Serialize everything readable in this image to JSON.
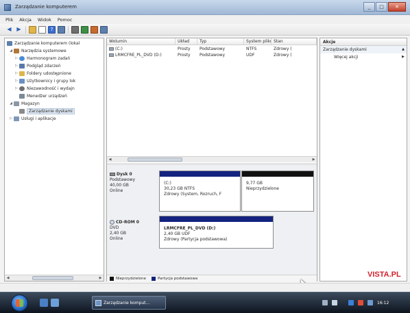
{
  "window": {
    "title": "Zarządzanie komputerem",
    "controls": [
      "_",
      "□",
      "✕"
    ]
  },
  "menu": [
    "Plik",
    "Akcja",
    "Widok",
    "Pomoc"
  ],
  "toolbar_icons": [
    "back-icon",
    "forward-icon",
    "up-folder-icon",
    "properties-icon",
    "help-icon",
    "console-tree-icon",
    "disk-icon",
    "check-icon",
    "volume-icon",
    "refresh-icon"
  ],
  "tree": {
    "items": [
      {
        "label": "Zarządzanie komputerem (lokal",
        "level": 0,
        "expander": ""
      },
      {
        "label": "Narzędzia systemowe",
        "level": 1,
        "expander": "◢"
      },
      {
        "label": "Harmonogram zadań",
        "level": 2,
        "expander": "▷"
      },
      {
        "label": "Podgląd zdarzeń",
        "level": 2,
        "expander": "▷"
      },
      {
        "label": "Foldery udostępnione",
        "level": 2,
        "expander": "▷"
      },
      {
        "label": "Użytkownicy i grupy lok",
        "level": 2,
        "expander": "▷"
      },
      {
        "label": "Niezawodność i wydajn",
        "level": 2,
        "expander": "▷"
      },
      {
        "label": "Menedżer urządzeń",
        "level": 2,
        "expander": ""
      },
      {
        "label": "Magazyn",
        "level": 1,
        "expander": "◢"
      },
      {
        "label": "Zarządzanie dyskami",
        "level": 2,
        "expander": ""
      },
      {
        "label": "Usługi i aplikacje",
        "level": 1,
        "expander": "▷"
      }
    ]
  },
  "volumes": {
    "columns": [
      "Wolumin",
      "Układ",
      "Typ",
      "System plików",
      "Stan"
    ],
    "rows": [
      [
        "(C:)",
        "Prosty",
        "Podstawowy",
        "NTFS",
        "Zdrowy ("
      ],
      [
        "LRMCFRE_PL_DVD (D:)",
        "Prosty",
        "Podstawowy",
        "UDF",
        "Zdrowy ("
      ]
    ]
  },
  "disks": [
    {
      "name": "Dysk 0",
      "type": "Podstawowy",
      "size": "40,00 GB",
      "status": "Online",
      "partitions": [
        {
          "name": "(C:)",
          "line2": "30,23 GB NTFS",
          "line3": "Zdrowy (System, Rozruch, F",
          "color": "#13237f"
        },
        {
          "name": "",
          "line2": "9,77 GB",
          "line3": "Nieprzydzielone",
          "color": "#111111"
        }
      ]
    },
    {
      "name": "CD-ROM 0",
      "type": "DVD",
      "size": "2,40 GB",
      "status": "Online",
      "partitions": [
        {
          "name": "LRMCFRE_PL_DVD (D:)",
          "line2": "2,40 GB UDF",
          "line3": "Zdrowy (Partycja podstawowa)",
          "color": "#13237f"
        }
      ]
    }
  ],
  "legend": [
    {
      "label": "Nieprzydzielone",
      "color": "#111111"
    },
    {
      "label": "Partycja podstawowa",
      "color": "#13237f"
    }
  ],
  "actions": {
    "header": "Akcje",
    "section": "Zarządzanie dyskami",
    "more": "Więcej akcji"
  },
  "watermark": "VISTA.PL",
  "taskbar": {
    "task_label": "Zarządzanie komput...",
    "time": "16:12"
  }
}
